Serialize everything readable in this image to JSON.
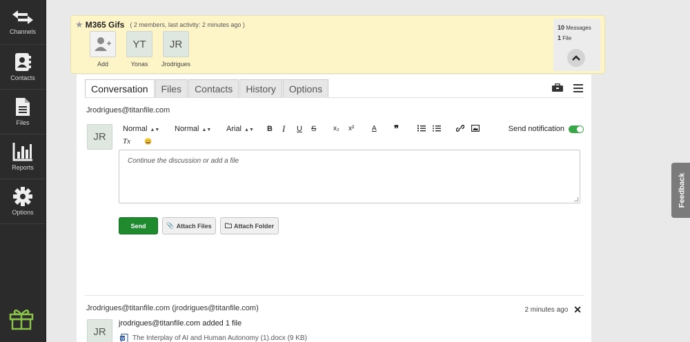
{
  "sidebar": {
    "items": [
      {
        "label": "Channels",
        "icon": "arrows-icon"
      },
      {
        "label": "Contacts",
        "icon": "contacts-icon"
      },
      {
        "label": "Files",
        "icon": "file-icon"
      },
      {
        "label": "Reports",
        "icon": "bar-chart-icon"
      },
      {
        "label": "Options",
        "icon": "gear-icon"
      }
    ],
    "bottom_icon": "gift-icon"
  },
  "channel": {
    "name": "M365 Gifs",
    "meta": "( 2 members, last activity: 2 minutes ago )",
    "members": [
      {
        "initials": "",
        "label": "Add"
      },
      {
        "initials": "YT",
        "label": "Yonas"
      },
      {
        "initials": "JR",
        "label": "Jrodrigues"
      }
    ],
    "stats": {
      "messages_count": "10",
      "messages_label": "Messages",
      "files_count": "1",
      "files_label": "File"
    }
  },
  "tabs": [
    {
      "label": "Conversation",
      "active": true
    },
    {
      "label": "Files",
      "active": false
    },
    {
      "label": "Contacts",
      "active": false
    },
    {
      "label": "History",
      "active": false
    },
    {
      "label": "Options",
      "active": false
    }
  ],
  "composer": {
    "owner": "Jrodrigues@titanfile.com",
    "avatar": "JR",
    "toolbar": {
      "heading": "Normal",
      "size": "Normal",
      "font": "Arial",
      "bold": "B",
      "italic": "I",
      "underline": "U",
      "subscript": "x₂",
      "superscript": "x²",
      "color": "A",
      "quote": "❞",
      "clear": "Tx",
      "emoji": "😀",
      "notify_label": "Send notification"
    },
    "placeholder": "Continue the discussion or add a file",
    "send": "Send",
    "attach_files": "Attach Files",
    "attach_folder": "Attach Folder"
  },
  "activity": {
    "author": "Jrodrigues@titanfile.com (jrodrigues@titanfile.com)",
    "time": "2 minutes ago",
    "avatar": "JR",
    "text": "jrodrigues@titanfile.com added 1 file",
    "file": "The Interplay of AI and Human Autonomy (1).docx (9 KB)"
  },
  "feedback": "Feedback",
  "colors": {
    "accent_green": "#1f8a2e",
    "header_bg": "#fdf5c8",
    "sidebar_bg": "#2b2b2b"
  }
}
